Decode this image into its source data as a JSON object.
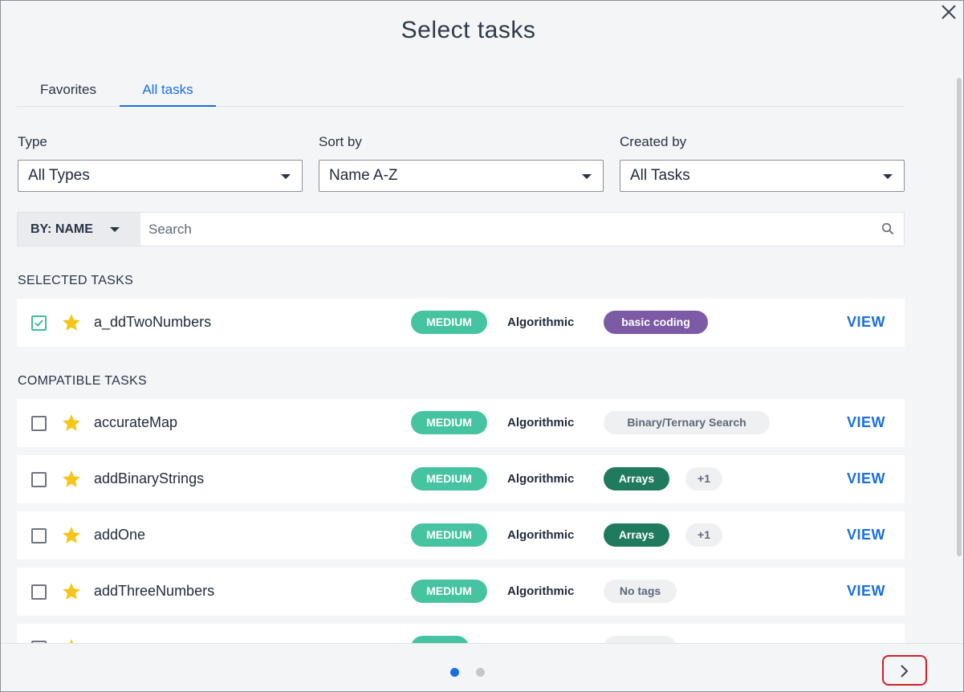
{
  "dialog": {
    "title": "Select tasks"
  },
  "tabs": [
    {
      "label": "Favorites",
      "active": false
    },
    {
      "label": "All tasks",
      "active": true
    }
  ],
  "filters": {
    "type": {
      "label": "Type",
      "value": "All Types"
    },
    "sort": {
      "label": "Sort by",
      "value": "Name A-Z"
    },
    "created": {
      "label": "Created by",
      "value": "All Tasks"
    }
  },
  "search": {
    "mode": "BY: NAME",
    "placeholder": "Search",
    "value": ""
  },
  "sections": {
    "selected": "SELECTED TASKS",
    "compatible": "COMPATIBLE TASKS"
  },
  "selected_tasks": [
    {
      "name": "a_ddTwoNumbers",
      "checked": true,
      "favorite": true,
      "difficulty": "MEDIUM",
      "type": "Algorithmic",
      "tags": [
        "basic coding"
      ],
      "view": "VIEW"
    }
  ],
  "compatible_tasks": [
    {
      "name": "accurateMap",
      "checked": false,
      "favorite": true,
      "difficulty": "MEDIUM",
      "type": "Algorithmic",
      "tags": [
        "Binary/Ternary Search"
      ],
      "view": "VIEW"
    },
    {
      "name": "addBinaryStrings",
      "checked": false,
      "favorite": true,
      "difficulty": "MEDIUM",
      "type": "Algorithmic",
      "tags": [
        "Arrays",
        "+1"
      ],
      "view": "VIEW"
    },
    {
      "name": "addOne",
      "checked": false,
      "favorite": true,
      "difficulty": "MEDIUM",
      "type": "Algorithmic",
      "tags": [
        "Arrays",
        "+1"
      ],
      "view": "VIEW"
    },
    {
      "name": "addThreeNumbers",
      "checked": false,
      "favorite": true,
      "difficulty": "MEDIUM",
      "type": "Algorithmic",
      "tags": [
        "No tags"
      ],
      "view": "VIEW"
    }
  ],
  "pagination": {
    "pages": 2,
    "current": 1
  },
  "colors": {
    "accent": "#1a6fe0",
    "medium": "#46c4a1",
    "star": "#f5c518",
    "tag_purple": "#7d5aa6",
    "tag_green": "#1f7a5e",
    "highlight": "#d0202a"
  },
  "icons": {
    "close": "close-icon",
    "search": "search-icon",
    "star": "star-icon",
    "next": "chevron-right-icon"
  }
}
